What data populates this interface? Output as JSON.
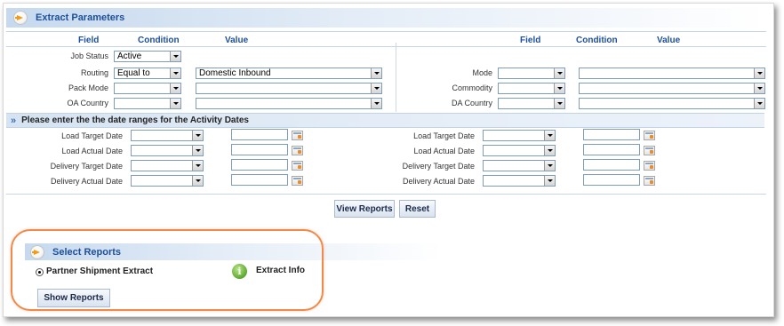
{
  "extract_header": {
    "title": "Extract Parameters"
  },
  "columns": {
    "field": "Field",
    "condition": "Condition",
    "value": "Value"
  },
  "left_rows": {
    "job_status": {
      "label": "Job Status",
      "condition": "Active"
    },
    "routing": {
      "label": "Routing",
      "condition": "Equal to",
      "value": "Domestic Inbound"
    },
    "pack_mode": {
      "label": "Pack Mode",
      "condition": "",
      "value": ""
    },
    "oa_country": {
      "label": "OA Country",
      "condition": "",
      "value": ""
    }
  },
  "right_rows": {
    "mode": {
      "label": "Mode",
      "condition": "",
      "value": ""
    },
    "commodity": {
      "label": "Commodity",
      "condition": "",
      "value": ""
    },
    "da_country": {
      "label": "DA Country",
      "condition": "",
      "value": ""
    }
  },
  "date_band": {
    "title": "Please enter the the date ranges for the Activity Dates"
  },
  "date_rows": {
    "load_target": "Load Target Date",
    "load_actual": "Load Actual Date",
    "delivery_target": "Delivery Target Date",
    "delivery_actual": "Delivery Actual Date"
  },
  "buttons": {
    "view_reports": "View Reports",
    "reset": "Reset",
    "show_reports": "Show Reports"
  },
  "select_reports": {
    "title": "Select Reports",
    "option": "Partner Shipment Extract",
    "info_label": "Extract Info",
    "info_glyph": "i"
  },
  "colors": {
    "accent": "#1e4f9c",
    "highlight": "#ef8a4a",
    "arrow": "#f49b10"
  }
}
